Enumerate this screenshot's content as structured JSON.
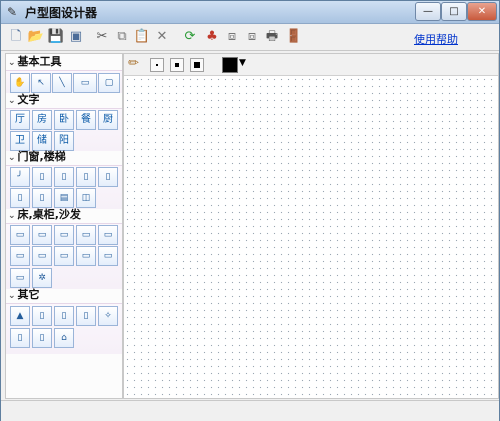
{
  "window": {
    "title": "户型图设计器",
    "minimize_label": "—",
    "maximize_label": "□",
    "close_label": "✕"
  },
  "toolbar": {
    "help_label": "使用帮助",
    "icons": [
      "new-icon",
      "open-icon",
      "save-icon",
      "save-as-icon",
      "cut-icon",
      "copy-icon",
      "paste-icon",
      "delete-icon",
      "refresh-icon",
      "color-fill-icon",
      "bring-front-icon",
      "send-back-icon",
      "print-icon",
      "exit-icon"
    ]
  },
  "sidebar": {
    "sections": [
      {
        "title": "基本工具",
        "tools": [
          "✋",
          "↖",
          "╲",
          "▭",
          "▢"
        ]
      },
      {
        "title": "文字",
        "tools": [
          "厅",
          "房",
          "卧",
          "餐",
          "厨",
          "卫",
          "储",
          "阳"
        ]
      },
      {
        "title": "门窗,楼梯",
        "tools": [
          "╯",
          "▯",
          "▯",
          "▯",
          "▯",
          "▯",
          "▯",
          "▤",
          "◫"
        ]
      },
      {
        "title": "床,桌柜,沙发",
        "tools": [
          "▭",
          "▭",
          "▭",
          "▭",
          "▭",
          "▭",
          "▭",
          "▭",
          "▭",
          "▭",
          "▭",
          "✲"
        ]
      },
      {
        "title": "其它",
        "tools": [
          "▲",
          "▯",
          "▯",
          "▯",
          "✧",
          "▯",
          "▯",
          "⌂"
        ]
      }
    ]
  },
  "canvas": {
    "brush_sizes": [
      "small",
      "medium",
      "large"
    ],
    "current_color": "#000000"
  },
  "colors": {
    "accent": "#4d6d99",
    "link": "#0033cc"
  }
}
